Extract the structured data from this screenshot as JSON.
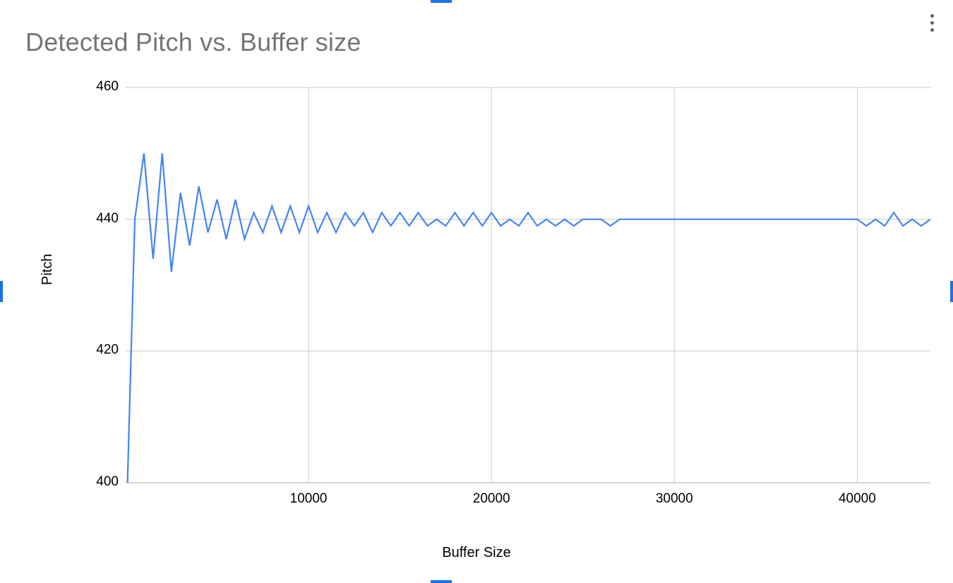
{
  "title": "Detected Pitch vs. Buffer size",
  "menu_icon": "kebab-menu",
  "chart_data": {
    "type": "line",
    "title": "Detected Pitch vs. Buffer size",
    "xlabel": "Buffer Size",
    "ylabel": "Pitch",
    "xlim": [
      0,
      44000
    ],
    "ylim": [
      400,
      460
    ],
    "xticks": [
      10000,
      20000,
      30000,
      40000
    ],
    "yticks": [
      400,
      420,
      440,
      460
    ],
    "series": [
      {
        "name": "Detected Pitch",
        "color": "#4285f4",
        "x": [
          100,
          500,
          1000,
          1500,
          2000,
          2500,
          3000,
          3500,
          4000,
          4500,
          5000,
          5500,
          6000,
          6500,
          7000,
          7500,
          8000,
          8500,
          9000,
          9500,
          10000,
          10500,
          11000,
          11500,
          12000,
          12500,
          13000,
          13500,
          14000,
          14500,
          15000,
          15500,
          16000,
          16500,
          17000,
          17500,
          18000,
          18500,
          19000,
          19500,
          20000,
          20500,
          21000,
          21500,
          22000,
          22500,
          23000,
          23500,
          24000,
          24500,
          25000,
          25500,
          26000,
          26500,
          27000,
          27500,
          28000,
          28500,
          29000,
          29500,
          30000,
          30500,
          31000,
          31500,
          32000,
          32500,
          33000,
          33500,
          34000,
          34500,
          35000,
          35500,
          36000,
          36500,
          37000,
          37500,
          38000,
          38500,
          39000,
          39500,
          40000,
          40500,
          41000,
          41500,
          42000,
          42500,
          43000,
          43500,
          44000
        ],
        "y": [
          400,
          440,
          450,
          434,
          450,
          432,
          444,
          436,
          445,
          438,
          443,
          437,
          443,
          437,
          441,
          438,
          442,
          438,
          442,
          438,
          442,
          438,
          441,
          438,
          441,
          439,
          441,
          438,
          441,
          439,
          441,
          439,
          441,
          439,
          440,
          439,
          441,
          439,
          441,
          439,
          441,
          439,
          440,
          439,
          441,
          439,
          440,
          439,
          440,
          439,
          440,
          440,
          440,
          439,
          440,
          440,
          440,
          440,
          440,
          440,
          440,
          440,
          440,
          440,
          440,
          440,
          440,
          440,
          440,
          440,
          440,
          440,
          440,
          440,
          440,
          440,
          440,
          440,
          440,
          440,
          440,
          439,
          440,
          439,
          441,
          439,
          440,
          439,
          440
        ]
      }
    ]
  }
}
